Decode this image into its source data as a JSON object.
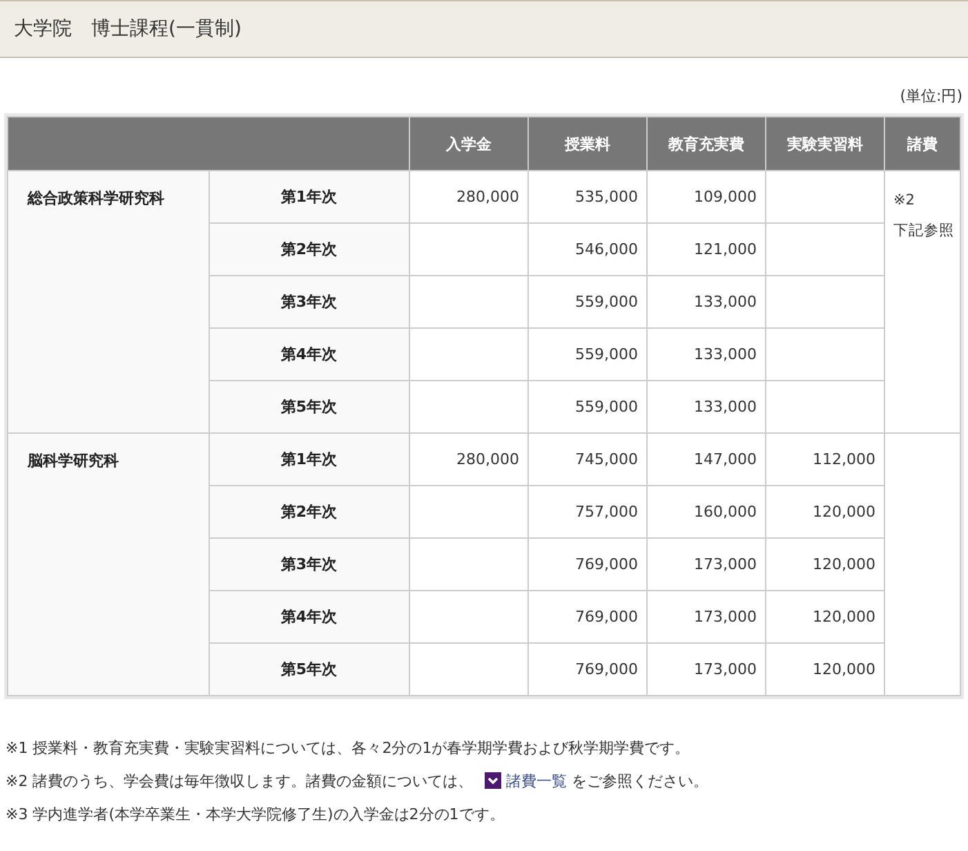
{
  "title": "大学院　博士課程(一貫制)",
  "unit": "(単位:円)",
  "table": {
    "columns": [
      "入学金",
      "授業料",
      "教育充実費",
      "実験実習料",
      "諸費"
    ],
    "departments": [
      {
        "name": "総合政策科学研究科",
        "misc": [
          "※2",
          "下記参照"
        ],
        "rows": [
          {
            "year": "第1年次",
            "entrance": "280,000",
            "tuition": "535,000",
            "education": "109,000"
          },
          {
            "year": "第2年次",
            "tuition": "546,000",
            "education": "121,000"
          },
          {
            "year": "第3年次",
            "tuition": "559,000",
            "education": "133,000"
          },
          {
            "year": "第4年次",
            "tuition": "559,000",
            "education": "133,000"
          },
          {
            "year": "第5年次",
            "tuition": "559,000",
            "education": "133,000"
          }
        ]
      },
      {
        "name": "脳科学研究科",
        "rows": [
          {
            "year": "第1年次",
            "entrance": "280,000",
            "tuition": "745,000",
            "education": "147,000",
            "lab": "112,000"
          },
          {
            "year": "第2年次",
            "tuition": "757,000",
            "education": "160,000",
            "lab": "120,000"
          },
          {
            "year": "第3年次",
            "tuition": "769,000",
            "education": "173,000",
            "lab": "120,000"
          },
          {
            "year": "第4年次",
            "tuition": "769,000",
            "education": "173,000",
            "lab": "120,000"
          },
          {
            "year": "第5年次",
            "tuition": "769,000",
            "education": "173,000",
            "lab": "120,000"
          }
        ]
      }
    ]
  },
  "notes": [
    {
      "mark": "※1",
      "text": "授業料・教育充実費・実験実習料については、各々2分の1が春学期学費および秋学期学費です。"
    },
    {
      "mark": "※2",
      "text": "諸費のうち、学会費は毎年徴収します。諸費の金額については、",
      "link": "諸費一覧",
      "after": "をご参照ください。"
    },
    {
      "mark": "※3",
      "text": "学内進学者(本学卒業生・本学大学院修了生)の入学金は2分の1です。"
    }
  ]
}
